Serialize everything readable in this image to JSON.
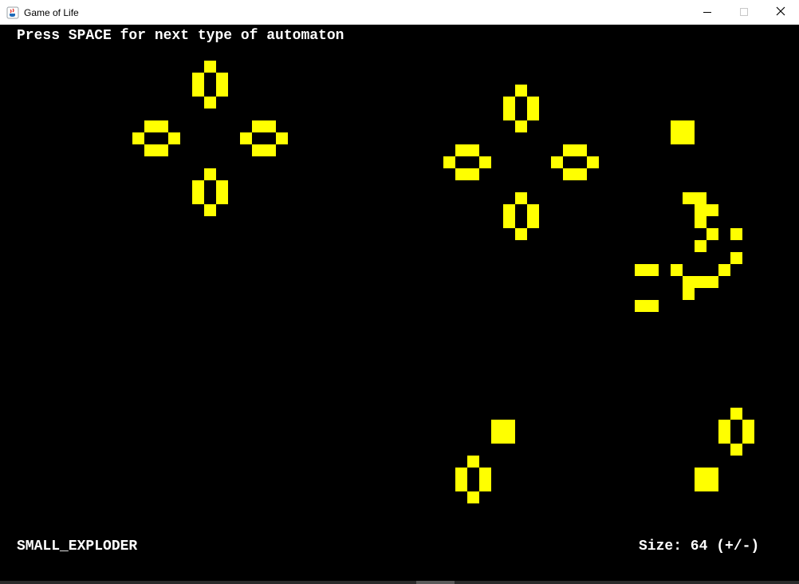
{
  "window": {
    "title": "Game of Life",
    "icon": "java-cup-icon",
    "controls": [
      "minimize-icon",
      "maximize-icon",
      "close-icon"
    ]
  },
  "hud": {
    "instruction": "Press SPACE for next type of automaton",
    "automaton_type": "SMALL_EXPLODER",
    "size_label": "Size: 64 (+/-)"
  },
  "colors": {
    "background": "#000000",
    "cell": "#ffff00",
    "text": "#ffffff"
  }
}
